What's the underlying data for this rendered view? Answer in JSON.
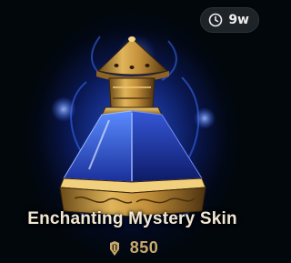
{
  "item": {
    "timer": "9w",
    "title": "Enchanting Mystery Skin",
    "price": "850",
    "currency_icon": "riot-points-icon",
    "timer_icon": "clock-icon",
    "image": "mystery-skin-vial"
  },
  "colors": {
    "background": "#02070c",
    "glow": "#2a5cff",
    "title": "#f0e6d2",
    "price": "#c8aa6e",
    "badge": "#1e2328"
  }
}
